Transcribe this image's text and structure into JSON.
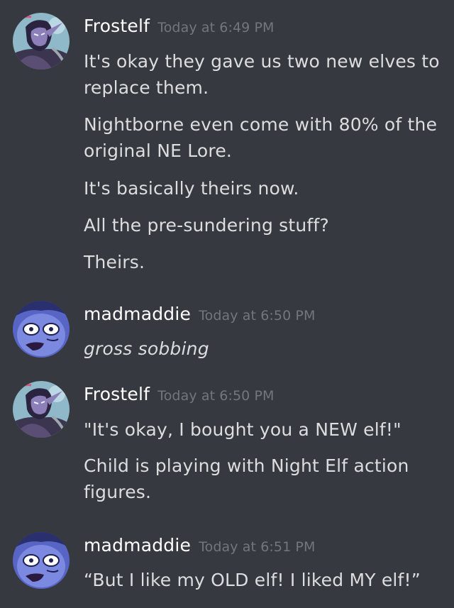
{
  "groups": [
    {
      "username": "Frostelf",
      "timestamp": "Today at 6:49 PM",
      "avatar": "night-elf-avatar",
      "lines": [
        "It's okay they gave us two new elves to replace them.",
        "Nightborne even come with 80% of the original NE Lore.",
        "It's basically theirs now.",
        "All the pre-sundering stuff?",
        "Theirs."
      ]
    },
    {
      "username": "madmaddie",
      "timestamp": "Today at 6:50 PM",
      "avatar": "blue-cartoon-face-avatar",
      "lines": [
        "gross sobbing"
      ]
    },
    {
      "username": "Frostelf",
      "timestamp": "Today at 6:50 PM",
      "avatar": "night-elf-avatar",
      "lines": [
        "\"It's okay, I bought you a NEW elf!\"",
        "Child is playing with Night Elf action figures."
      ]
    },
    {
      "username": "madmaddie",
      "timestamp": "Today at 6:51 PM",
      "avatar": "blue-cartoon-face-avatar",
      "lines": [
        "“But I like my OLD elf! I liked MY elf!”"
      ]
    }
  ],
  "colors": {
    "background": "#36393f",
    "username": "#ffffff",
    "timestamp": "#72767d",
    "text": "#dcddde"
  }
}
